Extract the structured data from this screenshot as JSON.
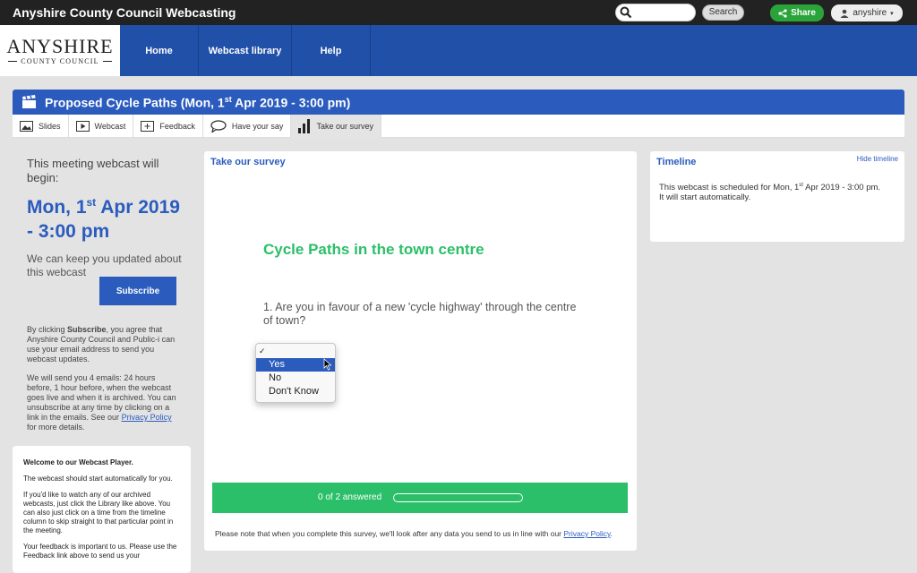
{
  "topbar": {
    "title": "Anyshire County Council Webcasting",
    "search_placeholder": "",
    "search_label": "Search",
    "share_label": "Share",
    "user_label": "anyshire"
  },
  "logo": {
    "main": "ANYSHIRE",
    "sub": "COUNTY COUNCIL"
  },
  "nav": {
    "items": [
      "Home",
      "Webcast library",
      "Help"
    ]
  },
  "meeting": {
    "title_prefix": "Proposed Cycle Paths (Mon, 1",
    "title_sup": "st",
    "title_suffix": " Apr 2019 - 3:00 pm)"
  },
  "tabs": [
    "Slides",
    "Webcast",
    "Feedback",
    "Have your say",
    "Take our survey"
  ],
  "left": {
    "begin_text": "This meeting webcast will begin:",
    "date_prefix": "Mon, 1",
    "date_sup": "st",
    "date_suffix": " Apr 2019 - 3:00 pm",
    "keep_text": "We can keep you updated about this webcast",
    "subscribe_label": "Subscribe",
    "consent_prefix": "By clicking ",
    "consent_bold": "Subscribe",
    "consent_suffix": ", you agree that Anyshire County Council and Public-i can use your email address to send you webcast updates.",
    "emails_text": "We will send you 4 emails: 24 hours before, 1 hour before, when the webcast goes live and when it is archived. You can unsubscribe at any time by clicking on a link in the emails. See our ",
    "privacy_link": "Privacy Policy",
    "emails_suffix": " for more details."
  },
  "welcome": {
    "title": "Welcome to our Webcast Player.",
    "p1": "The webcast should start automatically for you.",
    "p2": "If you'd like to watch any of our archived webcasts, just click the Library like above. You can also just click on a time from the timeline column to skip straight to that particular point in the meeting.",
    "p3": "Your feedback is important to us. Please use the Feedback link above to send us your"
  },
  "survey": {
    "heading": "Take our survey",
    "title": "Cycle Paths in the town centre",
    "question": "1. Are you in favour of a new 'cycle highway' through the centre of town?",
    "dropdown_check": "✓",
    "options": [
      "Yes",
      "No",
      "Don't Know"
    ],
    "highlighted_option": "Yes",
    "progress_text": "0 of 2 answered",
    "progress_fraction": 0,
    "note_prefix": "Please note that when you complete this survey, we'll look after any data you send to us in line with our ",
    "note_link": "Privacy Policy",
    "note_suffix": "."
  },
  "timeline": {
    "heading": "Timeline",
    "hide_label": "Hide timeline",
    "text_prefix": "This webcast is scheduled for Mon, 1",
    "text_sup": "st",
    "text_suffix": " Apr 2019 - 3:00 pm.",
    "text_line2": "It will start automatically."
  },
  "colors": {
    "brand_blue": "#2a5bbd",
    "nav_blue": "#2150a8",
    "survey_green": "#2bbf69",
    "share_green": "#2aa43a"
  }
}
